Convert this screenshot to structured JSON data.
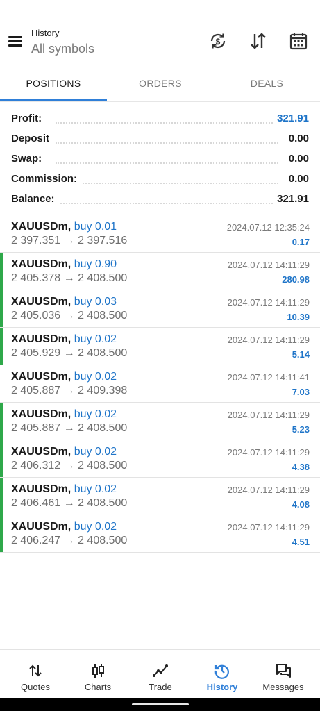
{
  "header": {
    "title": "History",
    "subtitle": "All symbols",
    "icons": [
      "sync-dollar-icon",
      "sort-icon",
      "calendar-icon"
    ]
  },
  "tabs": [
    {
      "label": "POSITIONS",
      "active": true
    },
    {
      "label": "ORDERS",
      "active": false
    },
    {
      "label": "DEALS",
      "active": false
    }
  ],
  "summary": [
    {
      "label": "Profit:",
      "value": "321.91",
      "highlight": true
    },
    {
      "label": "Deposit",
      "value": "0.00"
    },
    {
      "label": "Swap:",
      "value": "0.00"
    },
    {
      "label": "Commission:",
      "value": "0.00"
    },
    {
      "label": "Balance:",
      "value": "321.91"
    }
  ],
  "positions": [
    {
      "symbol": "XAUUSDm,",
      "direction": "buy 0.01",
      "prices": "2 397.351 → 2 397.516",
      "time": "2024.07.12 12:35:24",
      "profit": "0.17",
      "bar": false
    },
    {
      "symbol": "XAUUSDm,",
      "direction": "buy 0.90",
      "prices": "2 405.378 → 2 408.500",
      "time": "2024.07.12 14:11:29",
      "profit": "280.98",
      "bar": true
    },
    {
      "symbol": "XAUUSDm,",
      "direction": "buy 0.03",
      "prices": "2 405.036 → 2 408.500",
      "time": "2024.07.12 14:11:29",
      "profit": "10.39",
      "bar": true
    },
    {
      "symbol": "XAUUSDm,",
      "direction": "buy 0.02",
      "prices": "2 405.929 → 2 408.500",
      "time": "2024.07.12 14:11:29",
      "profit": "5.14",
      "bar": true
    },
    {
      "symbol": "XAUUSDm,",
      "direction": "buy 0.02",
      "prices": "2 405.887 → 2 409.398",
      "time": "2024.07.12 14:11:41",
      "profit": "7.03",
      "bar": false
    },
    {
      "symbol": "XAUUSDm,",
      "direction": "buy 0.02",
      "prices": "2 405.887 → 2 408.500",
      "time": "2024.07.12 14:11:29",
      "profit": "5.23",
      "bar": true
    },
    {
      "symbol": "XAUUSDm,",
      "direction": "buy 0.02",
      "prices": "2 406.312 → 2 408.500",
      "time": "2024.07.12 14:11:29",
      "profit": "4.38",
      "bar": true
    },
    {
      "symbol": "XAUUSDm,",
      "direction": "buy 0.02",
      "prices": "2 406.461 → 2 408.500",
      "time": "2024.07.12 14:11:29",
      "profit": "4.08",
      "bar": true
    },
    {
      "symbol": "XAUUSDm,",
      "direction": "buy 0.02",
      "prices": "2 406.247 → 2 408.500",
      "time": "2024.07.12 14:11:29",
      "profit": "4.51",
      "bar": true
    }
  ],
  "bottom_nav": [
    {
      "label": "Quotes",
      "icon": "quotes-icon"
    },
    {
      "label": "Charts",
      "icon": "charts-icon"
    },
    {
      "label": "Trade",
      "icon": "trade-icon"
    },
    {
      "label": "History",
      "icon": "history-icon",
      "active": true
    },
    {
      "label": "Messages",
      "icon": "messages-icon"
    }
  ],
  "colors": {
    "accent": "#2f7fd8",
    "profit_blue": "#1e74c8",
    "bar_green": "#2ea84a"
  }
}
